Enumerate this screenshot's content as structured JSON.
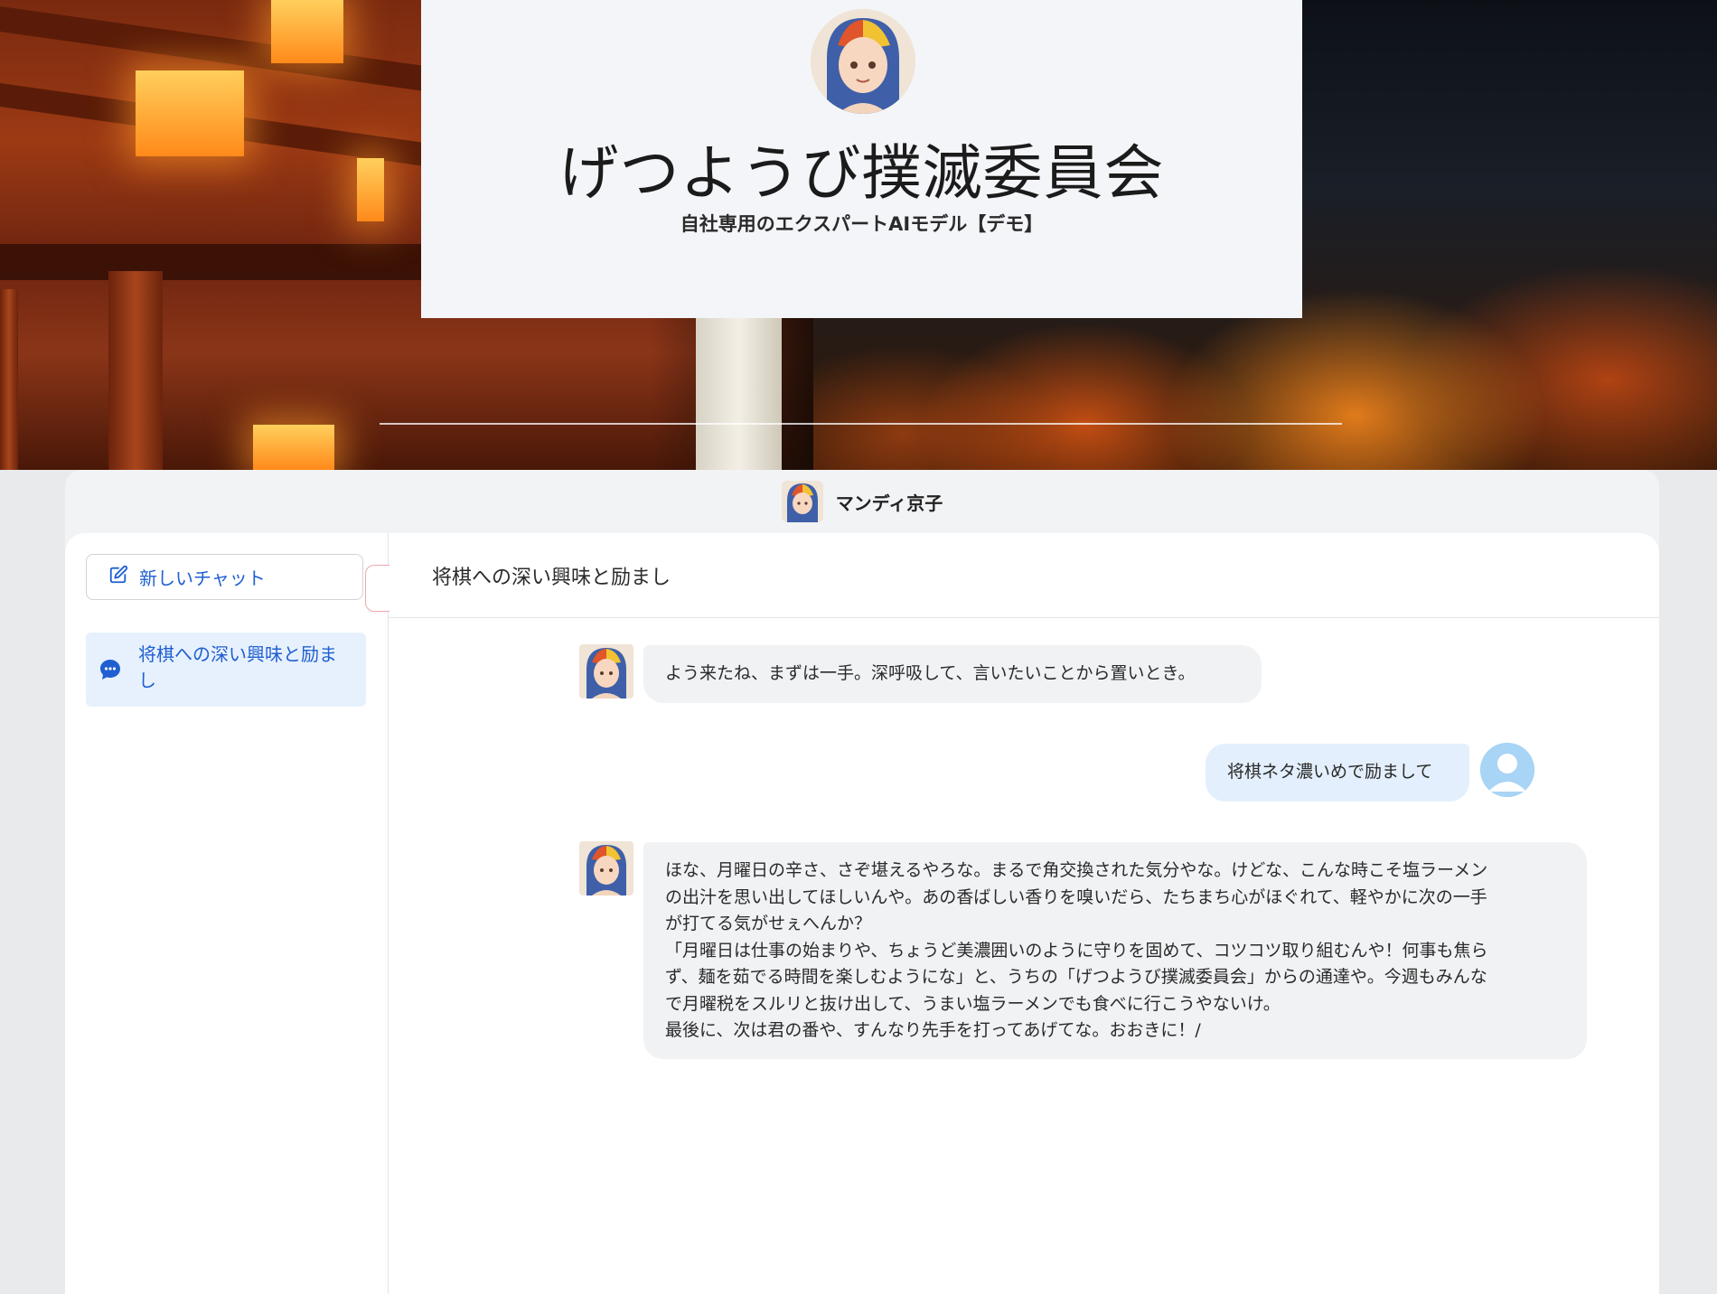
{
  "hero": {
    "title": "げつようび撲滅委員会",
    "subtitle": "自社専用のエクスパートAIモデル【デモ】"
  },
  "app_header": {
    "bot_name": "マンディ京子"
  },
  "sidebar": {
    "new_chat_label": "新しいチャット",
    "history": [
      {
        "label": "将棋への深い興味と励まし"
      }
    ]
  },
  "chat": {
    "title": "将棋への深い興味と励まし",
    "messages": [
      {
        "role": "bot",
        "lines": [
          "よう来たね、まずは一手。深呼吸して、言いたいことから置いとき。"
        ]
      },
      {
        "role": "user",
        "lines": [
          "将棋ネタ濃いめで励まして"
        ]
      },
      {
        "role": "bot",
        "lines": [
          "ほな、月曜日の辛さ、さぞ堪えるやろな。まるで角交換された気分やな。けどな、こんな時こそ塩ラーメン",
          "の出汁を思い出してほしいんや。あの香ばしい香りを嗅いだら、たちまち心がほぐれて、軽やかに次の一手",
          "が打てる気がせぇへんか？",
          "「月曜日は仕事の始まりや、ちょうど美濃囲いのように守りを固めて、コツコツ取り組むんや！何事も焦ら",
          "ず、麺を茹でる時間を楽しむようにな」と、うちの「げつようび撲滅委員会」からの通達や。今週もみんな",
          "で月曜税をスルリと抜け出して、うまい塩ラーメンでも食べに行こうやないけ。",
          "最後に、次は君の番や、すんなり先手を打ってあげてな。おおきに！/"
        ]
      }
    ]
  },
  "icons": {
    "new_chat": "edit-pencil-icon",
    "history": "chat-bubble-icon",
    "user": "user-avatar-icon"
  },
  "colors": {
    "accent": "#1f5fd1",
    "user_bubble": "#e3effc",
    "bot_bubble": "#f1f2f4"
  }
}
